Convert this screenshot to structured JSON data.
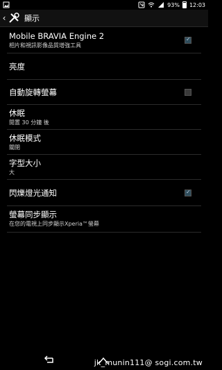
{
  "status_bar": {
    "battery_text": "93%",
    "time": "12:03"
  },
  "header": {
    "title": "顯示"
  },
  "settings": [
    {
      "title": "Mobile BRAVIA Engine 2",
      "subtitle": "相片和視訊影像品質增強工具",
      "checkbox": true
    },
    {
      "title": "亮度",
      "subtitle": "",
      "checkbox": null
    },
    {
      "title": "自動旋轉螢幕",
      "subtitle": "",
      "checkbox": false
    },
    {
      "title": "休眠",
      "subtitle": "閒置 30 分鐘 後",
      "checkbox": null
    },
    {
      "title": "休眠模式",
      "subtitle": "關閉",
      "checkbox": null
    },
    {
      "title": "字型大小",
      "subtitle": "大",
      "checkbox": null
    },
    {
      "title": "閃爍燈光通知",
      "subtitle": "",
      "checkbox": true
    },
    {
      "title": "螢幕同步顯示",
      "subtitle": "在您的電視上同步顯示Xperia™螢幕",
      "checkbox": null
    }
  ],
  "watermark": "jk_munin111@ sogi.com.tw",
  "icons": {
    "back": "chevron-left-icon",
    "settings_tools": "tools-icon",
    "nav_back": "back-arrow-icon",
    "nav_home": "home-icon"
  }
}
